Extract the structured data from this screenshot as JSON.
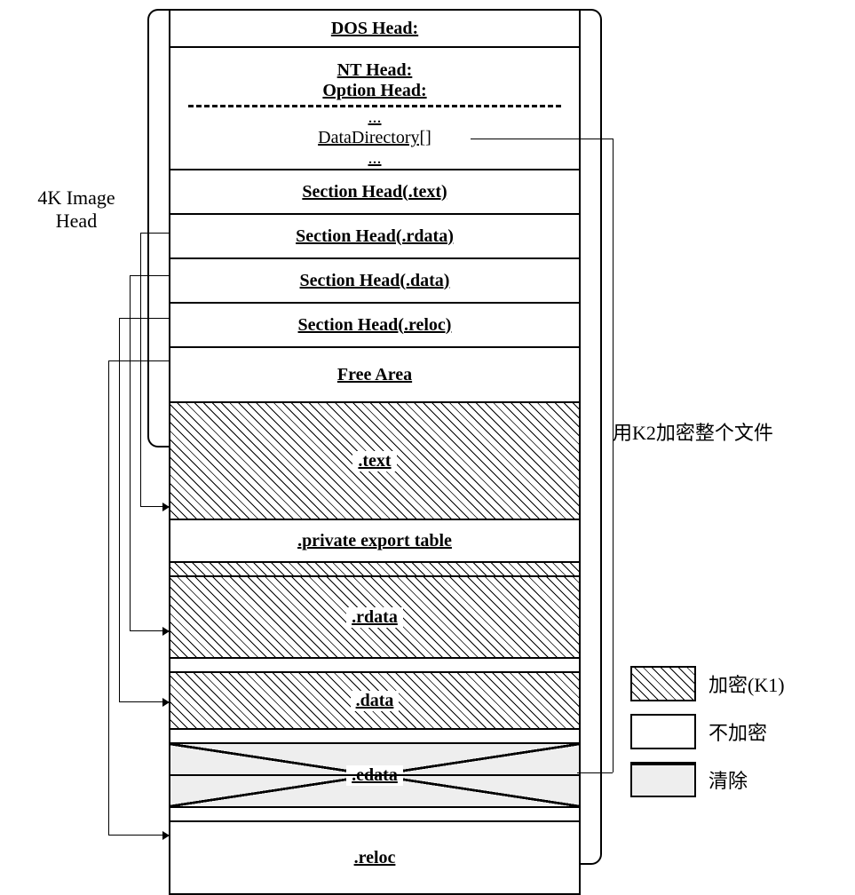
{
  "left_label_a": "4K Image",
  "left_label_b": "Head",
  "right_label": "用K2加密整个文件",
  "rows": {
    "dos": "DOS Head:",
    "nt": "NT Head:",
    "option": "Option Head:",
    "dots": "...",
    "datadir": "DataDirectory[]",
    "dots2": "...",
    "sh_text": "Section Head(.text)",
    "sh_rdata": "Section Head(.rdata)",
    "sh_data": "Section Head(.data)",
    "sh_reloc": "Section Head(.reloc)",
    "free": "Free Area",
    "text": ".text",
    "private": ".private export table",
    "rdata": ".rdata",
    "data": ".data",
    "edata": ".edata",
    "reloc": ".reloc"
  },
  "legend": {
    "encrypt_k1": "加密(K1)",
    "no_encrypt": "不加密",
    "clear": "清除"
  },
  "chart_data": {
    "type": "table",
    "title": "PE file layout encryption scheme",
    "image_header_size": "4K",
    "sections": [
      {
        "name": "DOS Head",
        "region": "Image Head",
        "k1_action": "no-encrypt"
      },
      {
        "name": "NT Head / Option Head",
        "region": "Image Head",
        "k1_action": "no-encrypt",
        "contains": [
          "DataDirectory[]"
        ]
      },
      {
        "name": "Section Head(.text)",
        "region": "Image Head",
        "k1_action": "no-encrypt",
        "points_to": ".text"
      },
      {
        "name": "Section Head(.rdata)",
        "region": "Image Head",
        "k1_action": "no-encrypt",
        "points_to": ".rdata"
      },
      {
        "name": "Section Head(.data)",
        "region": "Image Head",
        "k1_action": "no-encrypt",
        "points_to": ".data"
      },
      {
        "name": "Section Head(.reloc)",
        "region": "Image Head",
        "k1_action": "no-encrypt",
        "points_to": ".reloc"
      },
      {
        "name": "Free Area",
        "region": "Image Head",
        "k1_action": "no-encrypt"
      },
      {
        "name": ".text",
        "region": "body",
        "k1_action": "encrypt-K1"
      },
      {
        "name": ".private export table",
        "region": "body",
        "k1_action": "no-encrypt"
      },
      {
        "name": ".rdata",
        "region": "body",
        "k1_action": "encrypt-K1"
      },
      {
        "name": ".data",
        "region": "body",
        "k1_action": "encrypt-K1"
      },
      {
        "name": ".edata",
        "region": "body",
        "k1_action": "clear",
        "pointed_from": "DataDirectory[]"
      },
      {
        "name": ".reloc",
        "region": "body",
        "k1_action": "no-encrypt"
      }
    ],
    "outer_encryption": "K2 encrypts entire file",
    "legend": [
      {
        "pattern": "diagonal-hatch",
        "meaning": "加密(K1)"
      },
      {
        "pattern": "plain",
        "meaning": "不加密"
      },
      {
        "pattern": "crossed-dotted",
        "meaning": "清除"
      }
    ]
  }
}
